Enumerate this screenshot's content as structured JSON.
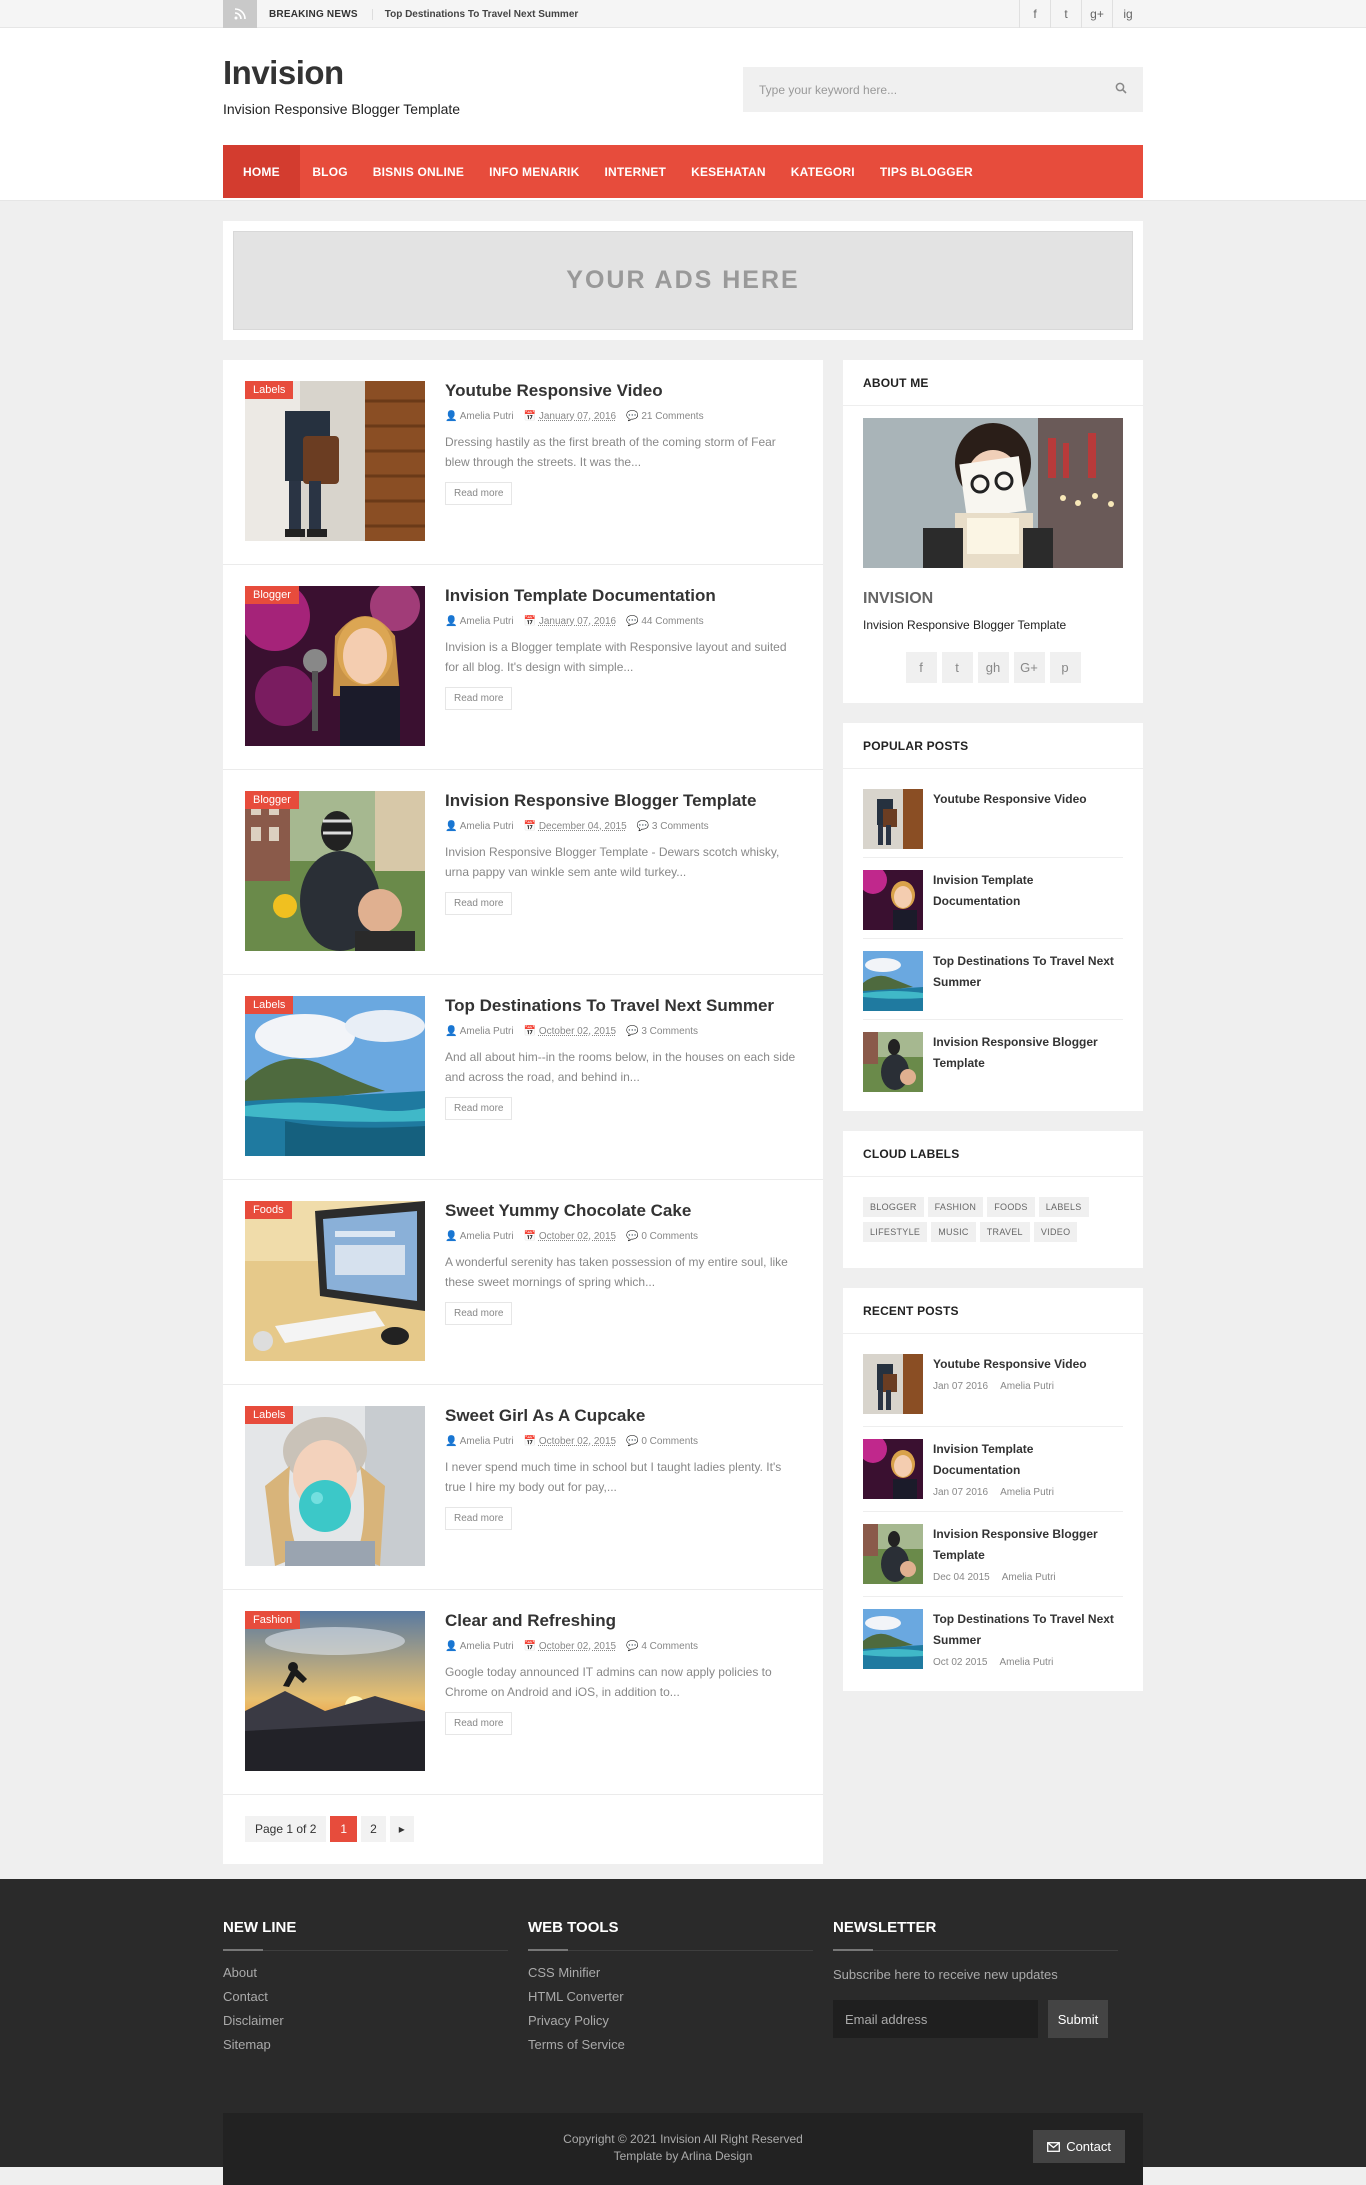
{
  "topbar": {
    "breaking_label": "BREAKING NEWS",
    "breaking_title": "Top Destinations To Travel Next Summer",
    "social": [
      "f",
      "t",
      "g+",
      "ig"
    ]
  },
  "header": {
    "logo": "Invision",
    "tagline": "Invision Responsive Blogger Template",
    "search_placeholder": "Type your keyword here..."
  },
  "nav": [
    "HOME",
    "BLOG",
    "BISNIS ONLINE",
    "INFO MENARIK",
    "INTERNET",
    "KESEHATAN",
    "KATEGORI",
    "TIPS BLOGGER"
  ],
  "ads": {
    "text": "YOUR ADS HERE"
  },
  "posts": [
    {
      "tag": "Labels",
      "title": "Youtube Responsive Video",
      "author": "Amelia Putri",
      "date": "January 07, 2016",
      "comments": "21 Comments",
      "excerpt": "Dressing hastily as the first breath of the coming storm of Fear blew through the streets. It was the...",
      "more": "Read more"
    },
    {
      "tag": "Blogger",
      "title": "Invision Template Documentation",
      "author": "Amelia Putri",
      "date": "January 07, 2016",
      "comments": "44 Comments",
      "excerpt": "Invision is a Blogger template with Responsive layout and suited for all blog. It's design with simple...",
      "more": "Read more"
    },
    {
      "tag": "Blogger",
      "title": "Invision Responsive Blogger Template",
      "author": "Amelia Putri",
      "date": "December 04, 2015",
      "comments": "3 Comments",
      "excerpt": "Invision Responsive Blogger Template - Dewars scotch whisky, urna pappy van winkle sem ante wild turkey...",
      "more": "Read more"
    },
    {
      "tag": "Labels",
      "title": "Top Destinations To Travel Next Summer",
      "author": "Amelia Putri",
      "date": "October 02, 2015",
      "comments": "3 Comments",
      "excerpt": "And all about him--in the rooms below, in the houses on each side and across the road, and behind in...",
      "more": "Read more"
    },
    {
      "tag": "Foods",
      "title": "Sweet Yummy Chocolate Cake",
      "author": "Amelia Putri",
      "date": "October 02, 2015",
      "comments": "0 Comments",
      "excerpt": "A wonderful serenity has taken possession of my entire soul, like these sweet mornings of spring which...",
      "more": "Read more"
    },
    {
      "tag": "Labels",
      "title": "Sweet Girl As A Cupcake",
      "author": "Amelia Putri",
      "date": "October 02, 2015",
      "comments": "0 Comments",
      "excerpt": "I never spend much time in school but I taught ladies plenty. It's true I hire my body out for pay,...",
      "more": "Read more"
    },
    {
      "tag": "Fashion",
      "title": "Clear and Refreshing",
      "author": "Amelia Putri",
      "date": "October 02, 2015",
      "comments": "4 Comments",
      "excerpt": "Google today announced IT admins can now apply policies to Chrome on Android and iOS, in addition to...",
      "more": "Read more"
    }
  ],
  "pager": {
    "label": "Page 1 of 2",
    "current": "1",
    "next_num": "2",
    "next_arrow": "▸"
  },
  "about": {
    "title": "ABOUT ME",
    "name": "INVISION",
    "desc": "Invision Responsive Blogger Template",
    "social": [
      "f",
      "t",
      "gh",
      "G+",
      "p"
    ]
  },
  "popular": {
    "title": "POPULAR POSTS",
    "items": [
      "Youtube Responsive Video",
      "Invision Template Documentation",
      "Top Destinations To Travel Next Summer",
      "Invision Responsive Blogger Template"
    ]
  },
  "labels": {
    "title": "CLOUD LABELS",
    "items": [
      "BLOGGER",
      "FASHION",
      "FOODS",
      "LABELS",
      "LIFESTYLE",
      "MUSIC",
      "TRAVEL",
      "VIDEO"
    ]
  },
  "recent": {
    "title": "RECENT POSTS",
    "items": [
      {
        "title": "Youtube Responsive Video",
        "date": "Jan 07 2016",
        "author": "Amelia Putri"
      },
      {
        "title": "Invision Template Documentation",
        "date": "Jan 07 2016",
        "author": "Amelia Putri"
      },
      {
        "title": "Invision Responsive Blogger Template",
        "date": "Dec 04 2015",
        "author": "Amelia Putri"
      },
      {
        "title": "Top Destinations To Travel Next Summer",
        "date": "Oct 02 2015",
        "author": "Amelia Putri"
      }
    ]
  },
  "footer": {
    "col1": {
      "title": "NEW LINE",
      "links": [
        "About",
        "Contact",
        "Disclaimer",
        "Sitemap"
      ]
    },
    "col2": {
      "title": "WEB TOOLS",
      "links": [
        "CSS Minifier",
        "HTML Converter",
        "Privacy Policy",
        "Terms of Service"
      ]
    },
    "col3": {
      "title": "NEWSLETTER",
      "desc": "Subscribe here to receive new updates",
      "placeholder": "Email address",
      "submit": "Submit"
    },
    "copyright": "Copyright © 2021 Invision All Right Reserved",
    "credit": "Template by Arlina Design",
    "contact": "Contact"
  },
  "colors": {
    "accent": "#e74c3c",
    "footer_bg": "#2a2a2a"
  }
}
